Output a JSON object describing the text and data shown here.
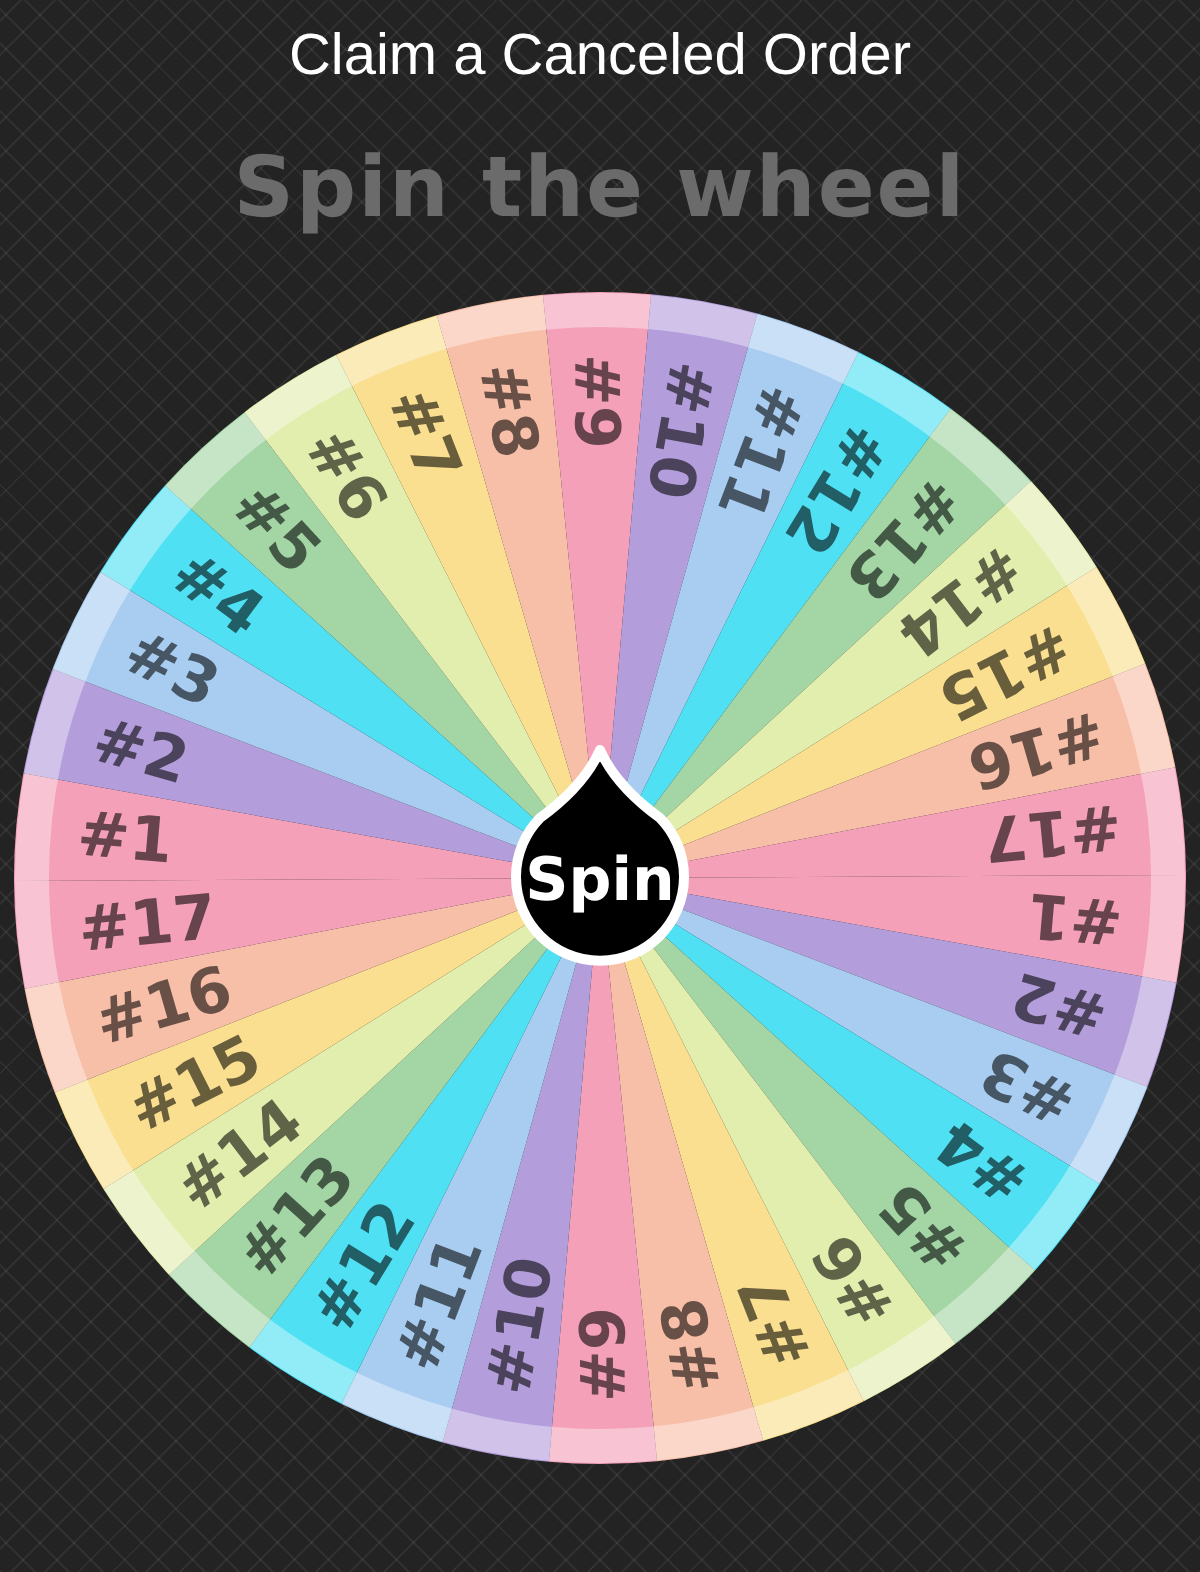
{
  "title": "Claim a Canceled Order",
  "heading": "Spin the wheel",
  "wheel": {
    "segments": [
      {
        "label": "#1",
        "color": "#f4a0b8"
      },
      {
        "label": "#2",
        "color": "#b39ddb"
      },
      {
        "label": "#3",
        "color": "#a9cdf0"
      },
      {
        "label": "#4",
        "color": "#4fe0f3"
      },
      {
        "label": "#5",
        "color": "#a3d5a5"
      },
      {
        "label": "#6",
        "color": "#e2eeae"
      },
      {
        "label": "#7",
        "color": "#f9df8f"
      },
      {
        "label": "#8",
        "color": "#f7bfa8"
      },
      {
        "label": "#9",
        "color": "#f4a0b8"
      },
      {
        "label": "#10",
        "color": "#b39ddb"
      },
      {
        "label": "#11",
        "color": "#a9cdf0"
      },
      {
        "label": "#12",
        "color": "#4fe0f3"
      },
      {
        "label": "#13",
        "color": "#a3d5a5"
      },
      {
        "label": "#14",
        "color": "#e2eeae"
      },
      {
        "label": "#15",
        "color": "#f9df8f"
      },
      {
        "label": "#16",
        "color": "#f7bfa8"
      },
      {
        "label": "#17",
        "color": "#f4a0b8"
      },
      {
        "label": "#1",
        "color": "#f4a0b8"
      },
      {
        "label": "#2",
        "color": "#b39ddb"
      },
      {
        "label": "#3",
        "color": "#a9cdf0"
      },
      {
        "label": "#4",
        "color": "#4fe0f3"
      },
      {
        "label": "#5",
        "color": "#a3d5a5"
      },
      {
        "label": "#6",
        "color": "#e2eeae"
      },
      {
        "label": "#7",
        "color": "#f9df8f"
      },
      {
        "label": "#8",
        "color": "#f7bfa8"
      },
      {
        "label": "#9",
        "color": "#f4a0b8"
      },
      {
        "label": "#10",
        "color": "#b39ddb"
      },
      {
        "label": "#11",
        "color": "#a9cdf0"
      },
      {
        "label": "#12",
        "color": "#4fe0f3"
      },
      {
        "label": "#13",
        "color": "#a3d5a5"
      },
      {
        "label": "#14",
        "color": "#e2eeae"
      },
      {
        "label": "#15",
        "color": "#f9df8f"
      },
      {
        "label": "#16",
        "color": "#f7bfa8"
      },
      {
        "label": "#17",
        "color": "#f4a0b8"
      }
    ]
  },
  "spin_button": {
    "label": "Spin"
  }
}
